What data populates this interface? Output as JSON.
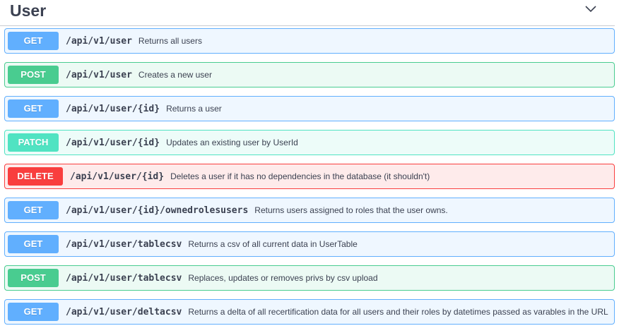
{
  "section": {
    "title": "User",
    "toggle_icon": "chevron-down-icon"
  },
  "operations": [
    {
      "method": "GET",
      "path": "/api/v1/user",
      "summary": "Returns all users"
    },
    {
      "method": "POST",
      "path": "/api/v1/user",
      "summary": "Creates a new user"
    },
    {
      "method": "GET",
      "path": "/api/v1/user/{id}",
      "summary": "Returns a user"
    },
    {
      "method": "PATCH",
      "path": "/api/v1/user/{id}",
      "summary": "Updates an existing user by UserId"
    },
    {
      "method": "DELETE",
      "path": "/api/v1/user/{id}",
      "summary": "Deletes a user if it has no dependencies in the database (it shouldn't)"
    },
    {
      "method": "GET",
      "path": "/api/v1/user/{id}/ownedrolesusers",
      "summary": "Returns users assigned to roles that the user owns."
    },
    {
      "method": "GET",
      "path": "/api/v1/user/tablecsv",
      "summary": "Returns a csv of all current data in UserTable"
    },
    {
      "method": "POST",
      "path": "/api/v1/user/tablecsv",
      "summary": "Replaces, updates or removes privs by csv upload"
    },
    {
      "method": "GET",
      "path": "/api/v1/user/deltacsv",
      "summary": "Returns a delta of all recertification data for all users and their roles by datetimes passed as varables in the URL"
    }
  ],
  "colors": {
    "get": "#61affe",
    "post": "#49cc90",
    "patch": "#50e3c2",
    "delete": "#f93e3e",
    "text": "#3b4151"
  }
}
